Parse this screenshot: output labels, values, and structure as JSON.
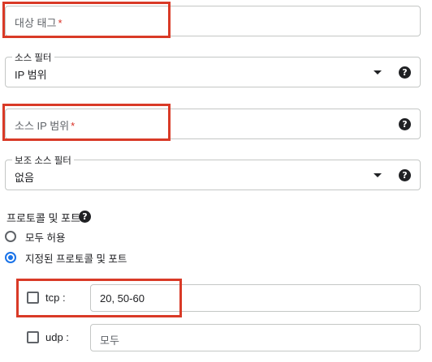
{
  "target_tags": {
    "placeholder": "대상 태그",
    "required_mark": "*"
  },
  "source_filter": {
    "label": "소스 필터",
    "selected": "IP 범위",
    "help": "?"
  },
  "source_ip_ranges": {
    "placeholder": "소스 IP 범위",
    "required_mark": "*",
    "help": "?"
  },
  "secondary_source_filter": {
    "label": "보조 소스 필터",
    "selected": "없음",
    "help": "?"
  },
  "protocols_ports": {
    "heading": "프로토콜 및 포트",
    "help": "?",
    "options": [
      {
        "label": "모두 허용",
        "selected": false
      },
      {
        "label": "지정된 프로토콜 및 포트",
        "selected": true
      }
    ],
    "tcp": {
      "label": "tcp :",
      "checked": false,
      "value": "20, 50-60"
    },
    "udp": {
      "label": "udp :",
      "checked": false,
      "placeholder": "모두"
    }
  },
  "colors": {
    "highlight": "#d93a27",
    "accent": "#1a73e8",
    "required": "#d93025"
  }
}
